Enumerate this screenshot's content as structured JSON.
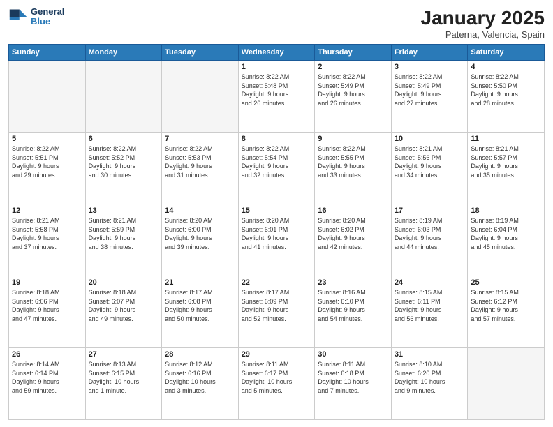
{
  "logo": {
    "line1": "General",
    "line2": "Blue"
  },
  "header": {
    "month": "January 2025",
    "location": "Paterna, Valencia, Spain"
  },
  "weekdays": [
    "Sunday",
    "Monday",
    "Tuesday",
    "Wednesday",
    "Thursday",
    "Friday",
    "Saturday"
  ],
  "weeks": [
    [
      {
        "day": "",
        "info": ""
      },
      {
        "day": "",
        "info": ""
      },
      {
        "day": "",
        "info": ""
      },
      {
        "day": "1",
        "info": "Sunrise: 8:22 AM\nSunset: 5:48 PM\nDaylight: 9 hours\nand 26 minutes."
      },
      {
        "day": "2",
        "info": "Sunrise: 8:22 AM\nSunset: 5:49 PM\nDaylight: 9 hours\nand 26 minutes."
      },
      {
        "day": "3",
        "info": "Sunrise: 8:22 AM\nSunset: 5:49 PM\nDaylight: 9 hours\nand 27 minutes."
      },
      {
        "day": "4",
        "info": "Sunrise: 8:22 AM\nSunset: 5:50 PM\nDaylight: 9 hours\nand 28 minutes."
      }
    ],
    [
      {
        "day": "5",
        "info": "Sunrise: 8:22 AM\nSunset: 5:51 PM\nDaylight: 9 hours\nand 29 minutes."
      },
      {
        "day": "6",
        "info": "Sunrise: 8:22 AM\nSunset: 5:52 PM\nDaylight: 9 hours\nand 30 minutes."
      },
      {
        "day": "7",
        "info": "Sunrise: 8:22 AM\nSunset: 5:53 PM\nDaylight: 9 hours\nand 31 minutes."
      },
      {
        "day": "8",
        "info": "Sunrise: 8:22 AM\nSunset: 5:54 PM\nDaylight: 9 hours\nand 32 minutes."
      },
      {
        "day": "9",
        "info": "Sunrise: 8:22 AM\nSunset: 5:55 PM\nDaylight: 9 hours\nand 33 minutes."
      },
      {
        "day": "10",
        "info": "Sunrise: 8:21 AM\nSunset: 5:56 PM\nDaylight: 9 hours\nand 34 minutes."
      },
      {
        "day": "11",
        "info": "Sunrise: 8:21 AM\nSunset: 5:57 PM\nDaylight: 9 hours\nand 35 minutes."
      }
    ],
    [
      {
        "day": "12",
        "info": "Sunrise: 8:21 AM\nSunset: 5:58 PM\nDaylight: 9 hours\nand 37 minutes."
      },
      {
        "day": "13",
        "info": "Sunrise: 8:21 AM\nSunset: 5:59 PM\nDaylight: 9 hours\nand 38 minutes."
      },
      {
        "day": "14",
        "info": "Sunrise: 8:20 AM\nSunset: 6:00 PM\nDaylight: 9 hours\nand 39 minutes."
      },
      {
        "day": "15",
        "info": "Sunrise: 8:20 AM\nSunset: 6:01 PM\nDaylight: 9 hours\nand 41 minutes."
      },
      {
        "day": "16",
        "info": "Sunrise: 8:20 AM\nSunset: 6:02 PM\nDaylight: 9 hours\nand 42 minutes."
      },
      {
        "day": "17",
        "info": "Sunrise: 8:19 AM\nSunset: 6:03 PM\nDaylight: 9 hours\nand 44 minutes."
      },
      {
        "day": "18",
        "info": "Sunrise: 8:19 AM\nSunset: 6:04 PM\nDaylight: 9 hours\nand 45 minutes."
      }
    ],
    [
      {
        "day": "19",
        "info": "Sunrise: 8:18 AM\nSunset: 6:06 PM\nDaylight: 9 hours\nand 47 minutes."
      },
      {
        "day": "20",
        "info": "Sunrise: 8:18 AM\nSunset: 6:07 PM\nDaylight: 9 hours\nand 49 minutes."
      },
      {
        "day": "21",
        "info": "Sunrise: 8:17 AM\nSunset: 6:08 PM\nDaylight: 9 hours\nand 50 minutes."
      },
      {
        "day": "22",
        "info": "Sunrise: 8:17 AM\nSunset: 6:09 PM\nDaylight: 9 hours\nand 52 minutes."
      },
      {
        "day": "23",
        "info": "Sunrise: 8:16 AM\nSunset: 6:10 PM\nDaylight: 9 hours\nand 54 minutes."
      },
      {
        "day": "24",
        "info": "Sunrise: 8:15 AM\nSunset: 6:11 PM\nDaylight: 9 hours\nand 56 minutes."
      },
      {
        "day": "25",
        "info": "Sunrise: 8:15 AM\nSunset: 6:12 PM\nDaylight: 9 hours\nand 57 minutes."
      }
    ],
    [
      {
        "day": "26",
        "info": "Sunrise: 8:14 AM\nSunset: 6:14 PM\nDaylight: 9 hours\nand 59 minutes."
      },
      {
        "day": "27",
        "info": "Sunrise: 8:13 AM\nSunset: 6:15 PM\nDaylight: 10 hours\nand 1 minute."
      },
      {
        "day": "28",
        "info": "Sunrise: 8:12 AM\nSunset: 6:16 PM\nDaylight: 10 hours\nand 3 minutes."
      },
      {
        "day": "29",
        "info": "Sunrise: 8:11 AM\nSunset: 6:17 PM\nDaylight: 10 hours\nand 5 minutes."
      },
      {
        "day": "30",
        "info": "Sunrise: 8:11 AM\nSunset: 6:18 PM\nDaylight: 10 hours\nand 7 minutes."
      },
      {
        "day": "31",
        "info": "Sunrise: 8:10 AM\nSunset: 6:20 PM\nDaylight: 10 hours\nand 9 minutes."
      },
      {
        "day": "",
        "info": ""
      }
    ]
  ]
}
